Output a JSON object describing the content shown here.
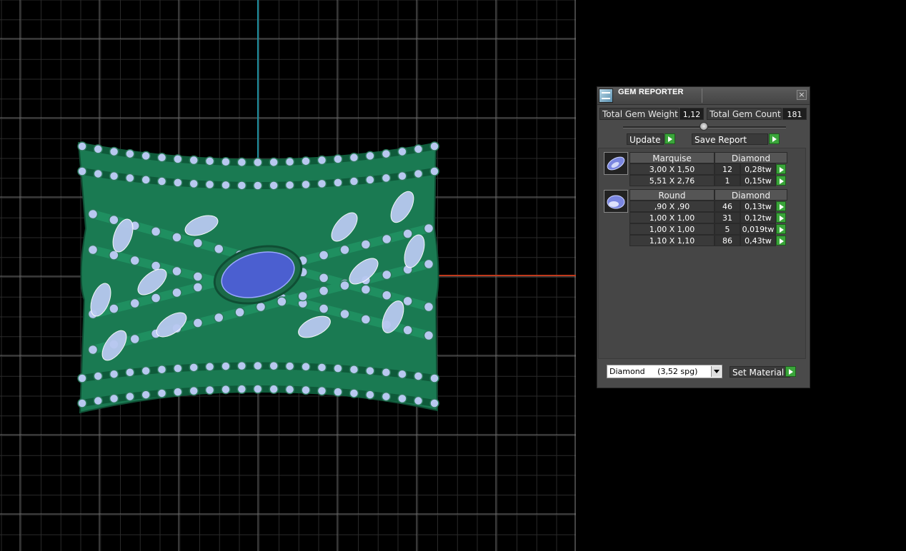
{
  "panel": {
    "title": "GEM REPORTER",
    "close_glyph": "×",
    "total_weight_label": "Total Gem Weight",
    "total_weight_value": "1,12",
    "total_count_label": "Total Gem Count",
    "total_count_value": "181",
    "update_label": "Update",
    "save_label": "Save Report",
    "groups": [
      {
        "shape": "Marquise",
        "material": "Diamond",
        "icon": "marquise-gem-icon",
        "rows": [
          {
            "size": "3,00 X 1,50",
            "count": "12",
            "weight": "0,28tw"
          },
          {
            "size": "5,51 X 2,76",
            "count": "1",
            "weight": "0,15tw"
          }
        ]
      },
      {
        "shape": "Round",
        "material": "Diamond",
        "icon": "round-gem-icon",
        "rows": [
          {
            "size": ",90 X ,90",
            "count": "46",
            "weight": "0,13tw"
          },
          {
            "size": "1,00 X 1,00",
            "count": "31",
            "weight": "0,12tw"
          },
          {
            "size": "1,00 X 1,00",
            "count": "5",
            "weight": "0,019tw"
          },
          {
            "size": "1,10 X 1,10",
            "count": "86",
            "weight": "0,43tw"
          }
        ]
      }
    ],
    "material_select": "Diamond     (3,52 spg)",
    "set_material_label": "Set Material"
  },
  "colors": {
    "grid": "#6e6e6e",
    "axis_y": "#1e8fa0",
    "axis_x": "#c0391b",
    "ring_metal": "#1a7a52",
    "gem_light": "#b8c8f0",
    "gem_center": "#4b5fd0",
    "play_button": "#3aa53a"
  }
}
